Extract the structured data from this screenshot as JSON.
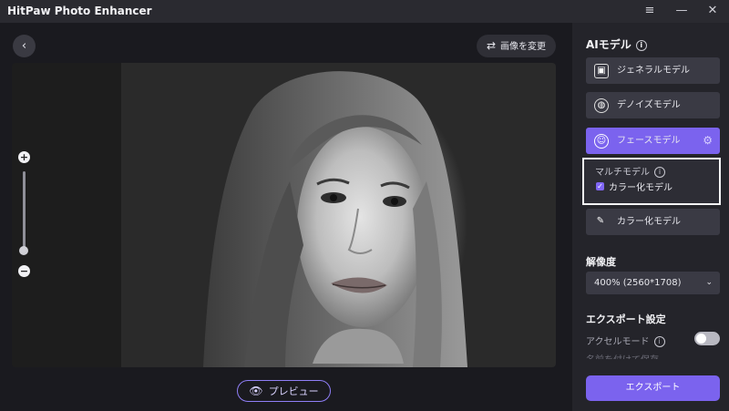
{
  "app": {
    "title": "HitPaw Photo Enhancer"
  },
  "window_controls": {
    "menu_icon": "≡",
    "minimize_icon": "—",
    "close_icon": "✕"
  },
  "toolbar": {
    "back_icon": "‹",
    "change_image_label": "画像を変更",
    "change_image_icon": "⇄"
  },
  "zoom": {
    "plus": "+",
    "minus": "−",
    "level_fraction": 0.1
  },
  "preview": {
    "label": "プレビュー",
    "icon": "👁"
  },
  "panel": {
    "ai_model_title": "AIモデル",
    "info_glyph": "i",
    "models": [
      {
        "label": "ジェネラルモデル",
        "icon": "image-icon",
        "glyph": "▣"
      },
      {
        "label": "デノイズモデル",
        "icon": "denoise-icon",
        "glyph": "◍"
      },
      {
        "label": "フェースモデル",
        "icon": "face-icon",
        "glyph": "☺",
        "selected": true,
        "settings_glyph": "⚙"
      },
      {
        "label": "カラー化モデル",
        "icon": "colorize-icon",
        "glyph": "✎"
      }
    ],
    "multi_model": {
      "title": "マルチモデル",
      "option_label": "カラー化モデル",
      "checked": true,
      "check_glyph": "✓"
    },
    "resolution": {
      "title": "解像度",
      "value": "400% (2560*1708)",
      "chevron": "⌄"
    },
    "export_settings": {
      "title": "エクスポート設定",
      "accel_label": "アクセルモード",
      "accel_on": false,
      "partial_label": "名前を付けて保存"
    },
    "export_button": "エクスポート"
  },
  "colors": {
    "accent": "#7b63ee",
    "panel_bg": "#24242a",
    "main_bg": "#1a1a1f"
  }
}
